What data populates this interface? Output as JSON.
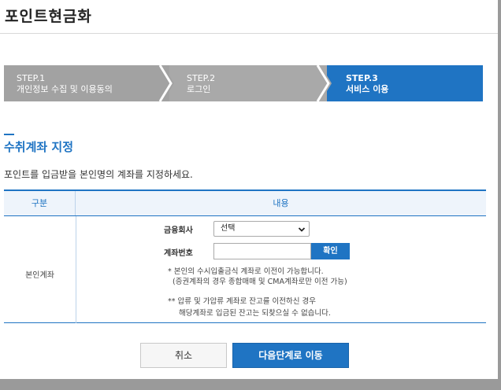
{
  "page": {
    "title": "포인트현금화"
  },
  "steps": [
    {
      "num": "STEP.1",
      "label": "개인정보 수집 및 이용동의"
    },
    {
      "num": "STEP.2",
      "label": "로그인"
    },
    {
      "num": "STEP.3",
      "label": "서비스 이용"
    }
  ],
  "section": {
    "title": "수취계좌 지정",
    "description": "포인트를 입금받을 본인명의 계좌를 지정하세요."
  },
  "table": {
    "headers": [
      "구분",
      "내용"
    ],
    "row_label": "본인계좌",
    "bank_label": "금융회사",
    "bank_select_value": "선택",
    "account_label": "계좌번호",
    "account_value": "",
    "confirm_label": "확인",
    "notes": [
      "* 본인의 수시입출금식 계좌로 이전이 가능합니다.",
      "(증권계좌의 경우 종합매매 및 CMA계좌로만 이전 가능)",
      "** 압류 및 가압류 계좌로 잔고를 이전하신 경우",
      "해당계좌로 입금된 잔고는 되찾으실 수 없습니다."
    ]
  },
  "buttons": {
    "cancel": "취소",
    "next": "다음단계로 이동"
  },
  "colors": {
    "accent": "#1f74c3",
    "step_inactive": "#a2a2a2"
  }
}
